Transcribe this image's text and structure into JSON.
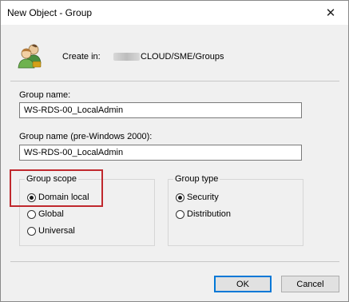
{
  "window": {
    "title": "New Object - Group",
    "close_glyph": "✕"
  },
  "header": {
    "icon": "users-group-icon",
    "create_in_label": "Create in:",
    "path_text": "CLOUD/SME/Groups"
  },
  "fields": {
    "group_name_label": "Group name:",
    "group_name_value": "WS-RDS-00_LocalAdmin",
    "group_name_pre2000_label": "Group name (pre-Windows 2000):",
    "group_name_pre2000_value": "WS-RDS-00_LocalAdmin"
  },
  "group_scope": {
    "title": "Group scope",
    "options": [
      {
        "label": "Domain local",
        "checked": true
      },
      {
        "label": "Global",
        "checked": false
      },
      {
        "label": "Universal",
        "checked": false
      }
    ]
  },
  "group_type": {
    "title": "Group type",
    "options": [
      {
        "label": "Security",
        "checked": true
      },
      {
        "label": "Distribution",
        "checked": false
      }
    ]
  },
  "buttons": {
    "ok": "OK",
    "cancel": "Cancel"
  },
  "colors": {
    "highlight": "#c0282d",
    "default_button_border": "#0078d7"
  }
}
